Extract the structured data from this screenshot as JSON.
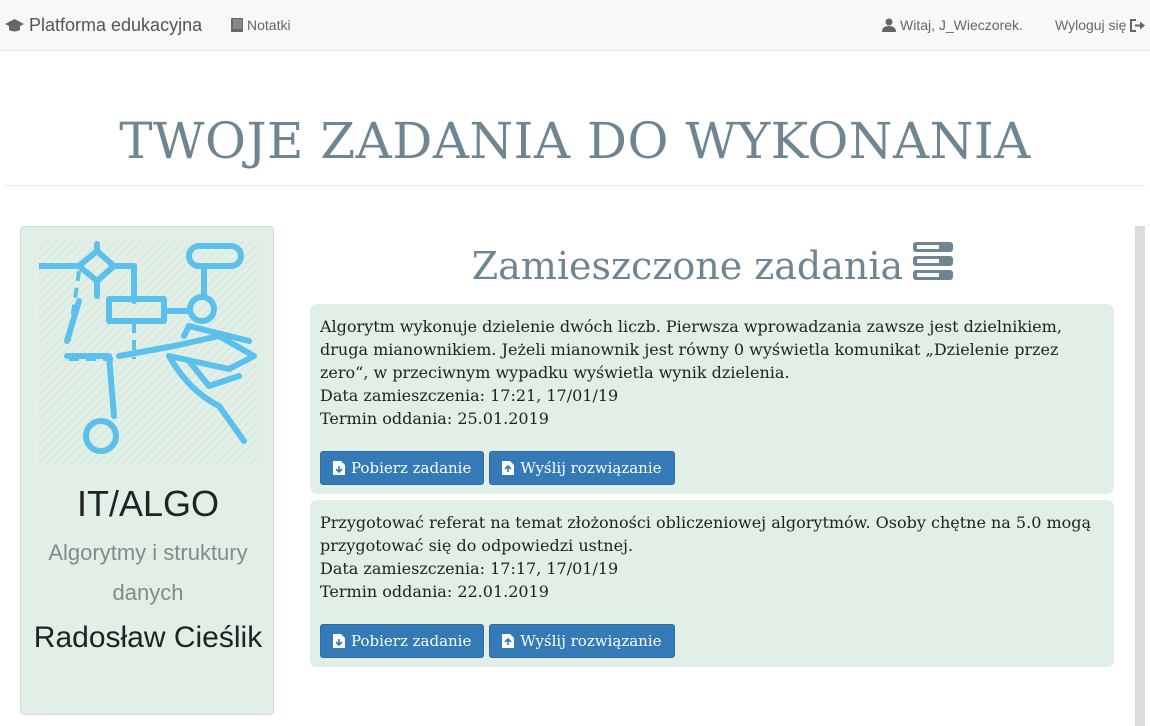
{
  "navbar": {
    "brand": "Platforma edukacyjna",
    "notes": "Notatki",
    "greeting": "Witaj, J_Wieczorek.",
    "logout": "Wyloguj się"
  },
  "page": {
    "title": "TWOJE ZADANIA DO WYKONANIA"
  },
  "course": {
    "code": "IT/ALGO",
    "name": "Algorytmy i struktury danych",
    "teacher": "Radosław Cieślik"
  },
  "tasks_section": {
    "title": "Zamieszczone zadania",
    "tasks": [
      {
        "description": "Algorytm wykonuje dzielenie dwóch liczb. Pierwsza wprowadzania zawsze jest dzielnikiem, druga mianownikiem. Jeżeli mianownik jest równy 0 wyświetla komunikat „Dzielenie przez zero“, w przeciwnym wypadku wyświetla wynik dzielenia.",
        "posted": "Data zamieszczenia: 17:21, 17/01/19",
        "deadline": "Termin oddania: 25.01.2019",
        "download_label": "Pobierz zadanie",
        "submit_label": "Wyślij rozwiązanie"
      },
      {
        "description": "Przygotować referat na temat złożoności obliczeniowej algorytmów. Osoby chętne na 5.0 mogą przygotować się do odpowiedzi ustnej.",
        "posted": "Data zamieszczenia: 17:17, 17/01/19",
        "deadline": "Termin oddania: 22.01.2019",
        "download_label": "Pobierz zadanie",
        "submit_label": "Wyślij rozwiązanie"
      }
    ]
  },
  "colors": {
    "accent": "#337ab7",
    "card_bg": "#e1efe6",
    "heading": "#6f8592"
  }
}
